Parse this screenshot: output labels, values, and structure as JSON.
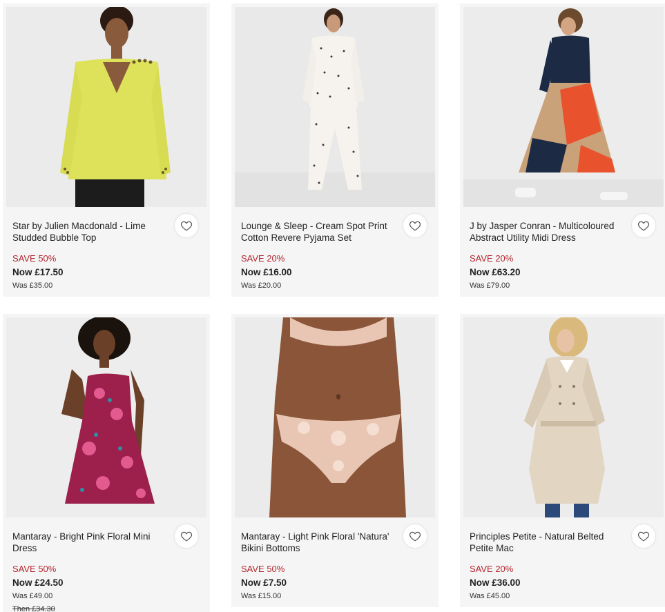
{
  "products": [
    {
      "title": "Star by Julien Macdonald - Lime Studded Bubble Top",
      "save": "SAVE 50%",
      "now": "Now £17.50",
      "was": "Was £35.00",
      "image": "model-lime-top",
      "colors": {
        "garment": "#dde25a",
        "bottom": "#1c1c1c",
        "bg": "#ebebeb"
      }
    },
    {
      "title": "Lounge & Sleep - Cream Spot Print Cotton Revere Pyjama Set",
      "save": "SAVE 20%",
      "now": "Now £16.00",
      "was": "Was £20.00",
      "image": "model-pyjama-set",
      "colors": {
        "garment": "#f6f3ee",
        "bottom": "#f6f3ee",
        "bg": "#e9e9e9"
      }
    },
    {
      "title": "J by Jasper Conran - Multicoloured Abstract Utility Midi Dress",
      "save": "SAVE 20%",
      "now": "Now £63.20",
      "was": "Was £79.00",
      "image": "model-abstract-dress",
      "colors": {
        "garment": "#1d2a44",
        "bottom": "#e8532e",
        "bg": "#ececec"
      }
    },
    {
      "title": "Mantaray - Bright Pink Floral Mini Dress",
      "save": "SAVE 50%",
      "now": "Now £24.50",
      "was": "Was £49.00",
      "then": "Then £34.30",
      "image": "model-pink-floral-dress",
      "colors": {
        "garment": "#9c1f4c",
        "bottom": "#9c1f4c",
        "bg": "#ededed"
      }
    },
    {
      "title": "Mantaray - Light Pink Floral 'Natura' Bikini Bottoms",
      "save": "SAVE 50%",
      "now": "Now £7.50",
      "was": "Was £15.00",
      "image": "model-bikini-bottoms",
      "colors": {
        "garment": "#e9c6b4",
        "bottom": "#e9c6b4",
        "bg": "#ebebeb"
      }
    },
    {
      "title": "Principles Petite - Natural Belted Petite Mac",
      "save": "SAVE 20%",
      "now": "Now £36.00",
      "was": "Was £45.00",
      "image": "model-natural-mac",
      "colors": {
        "garment": "#e2d6c3",
        "bottom": "#2b4a7a",
        "bg": "#ececec"
      }
    }
  ],
  "wishlist_icon": "heart-icon"
}
